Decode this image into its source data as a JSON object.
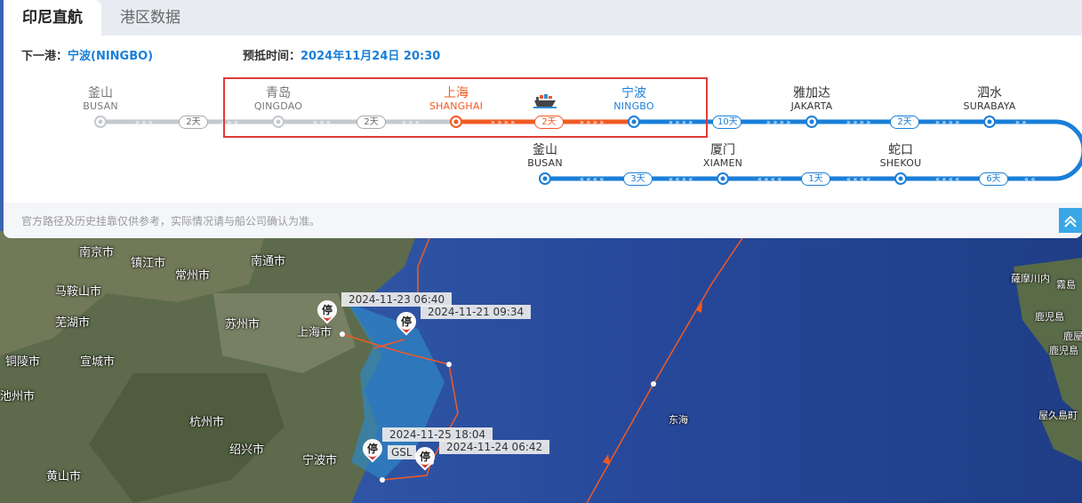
{
  "tabs": [
    {
      "label": "印尼直航",
      "active": true
    },
    {
      "label": "港区数据",
      "active": false
    }
  ],
  "next_port": {
    "label": "下一港：",
    "value": "宁波(NINGBO)"
  },
  "eta": {
    "label": "预抵时间：",
    "value": "2024年11月24日 20:30"
  },
  "route_top": [
    {
      "cn": "釜山",
      "en": "BUSAN",
      "state": "gray"
    },
    {
      "cn": "青岛",
      "en": "QINGDAO",
      "state": "gray"
    },
    {
      "cn": "上海",
      "en": "SHANGHAI",
      "state": "orange"
    },
    {
      "cn": "宁波",
      "en": "NINGBO",
      "state": "blue"
    },
    {
      "cn": "雅加达",
      "en": "JAKARTA",
      "state": "dark"
    },
    {
      "cn": "泗水",
      "en": "SURABAYA",
      "state": "dark"
    }
  ],
  "route_bottom": [
    {
      "cn": "釜山",
      "en": "BUSAN"
    },
    {
      "cn": "厦门",
      "en": "XIAMEN"
    },
    {
      "cn": "蛇口",
      "en": "SHEKOU"
    }
  ],
  "days_top": [
    {
      "label": "2天",
      "state": "gray"
    },
    {
      "label": "2天",
      "state": "gray"
    },
    {
      "label": "2天",
      "state": "orange"
    },
    {
      "label": "10天",
      "state": "blue"
    },
    {
      "label": "2天",
      "state": "blue"
    }
  ],
  "days_bottom": [
    "3天",
    "1天",
    "6天"
  ],
  "disclaimer": "官方路径及历史挂靠仅供参考，实际情况请与船公司确认为准。",
  "map": {
    "cities": [
      "南京市",
      "镇江市",
      "常州市",
      "南通市",
      "马鞍山市",
      "芜湖市",
      "苏州市",
      "上海市",
      "铜陵市",
      "宣城市",
      "池州市",
      "杭州市",
      "绍兴市",
      "宁波市",
      "黄山市",
      "东海",
      "薩摩川内",
      "霧島",
      "鹿児島",
      "鹿屋",
      "鹿児島",
      "屋久島町"
    ],
    "time_tags": [
      "2024-11-23 06:40",
      "2024-11-21 09:34",
      "2024-11-25 18:04",
      "2024-11-24 06:42"
    ],
    "vessel_label": "GSL",
    "stop_glyph": "停"
  },
  "colors": {
    "gray": "#c4c8cf",
    "orange": "#f15a22",
    "blue": "#1a7fd8",
    "highlight": "#e03b3b"
  }
}
